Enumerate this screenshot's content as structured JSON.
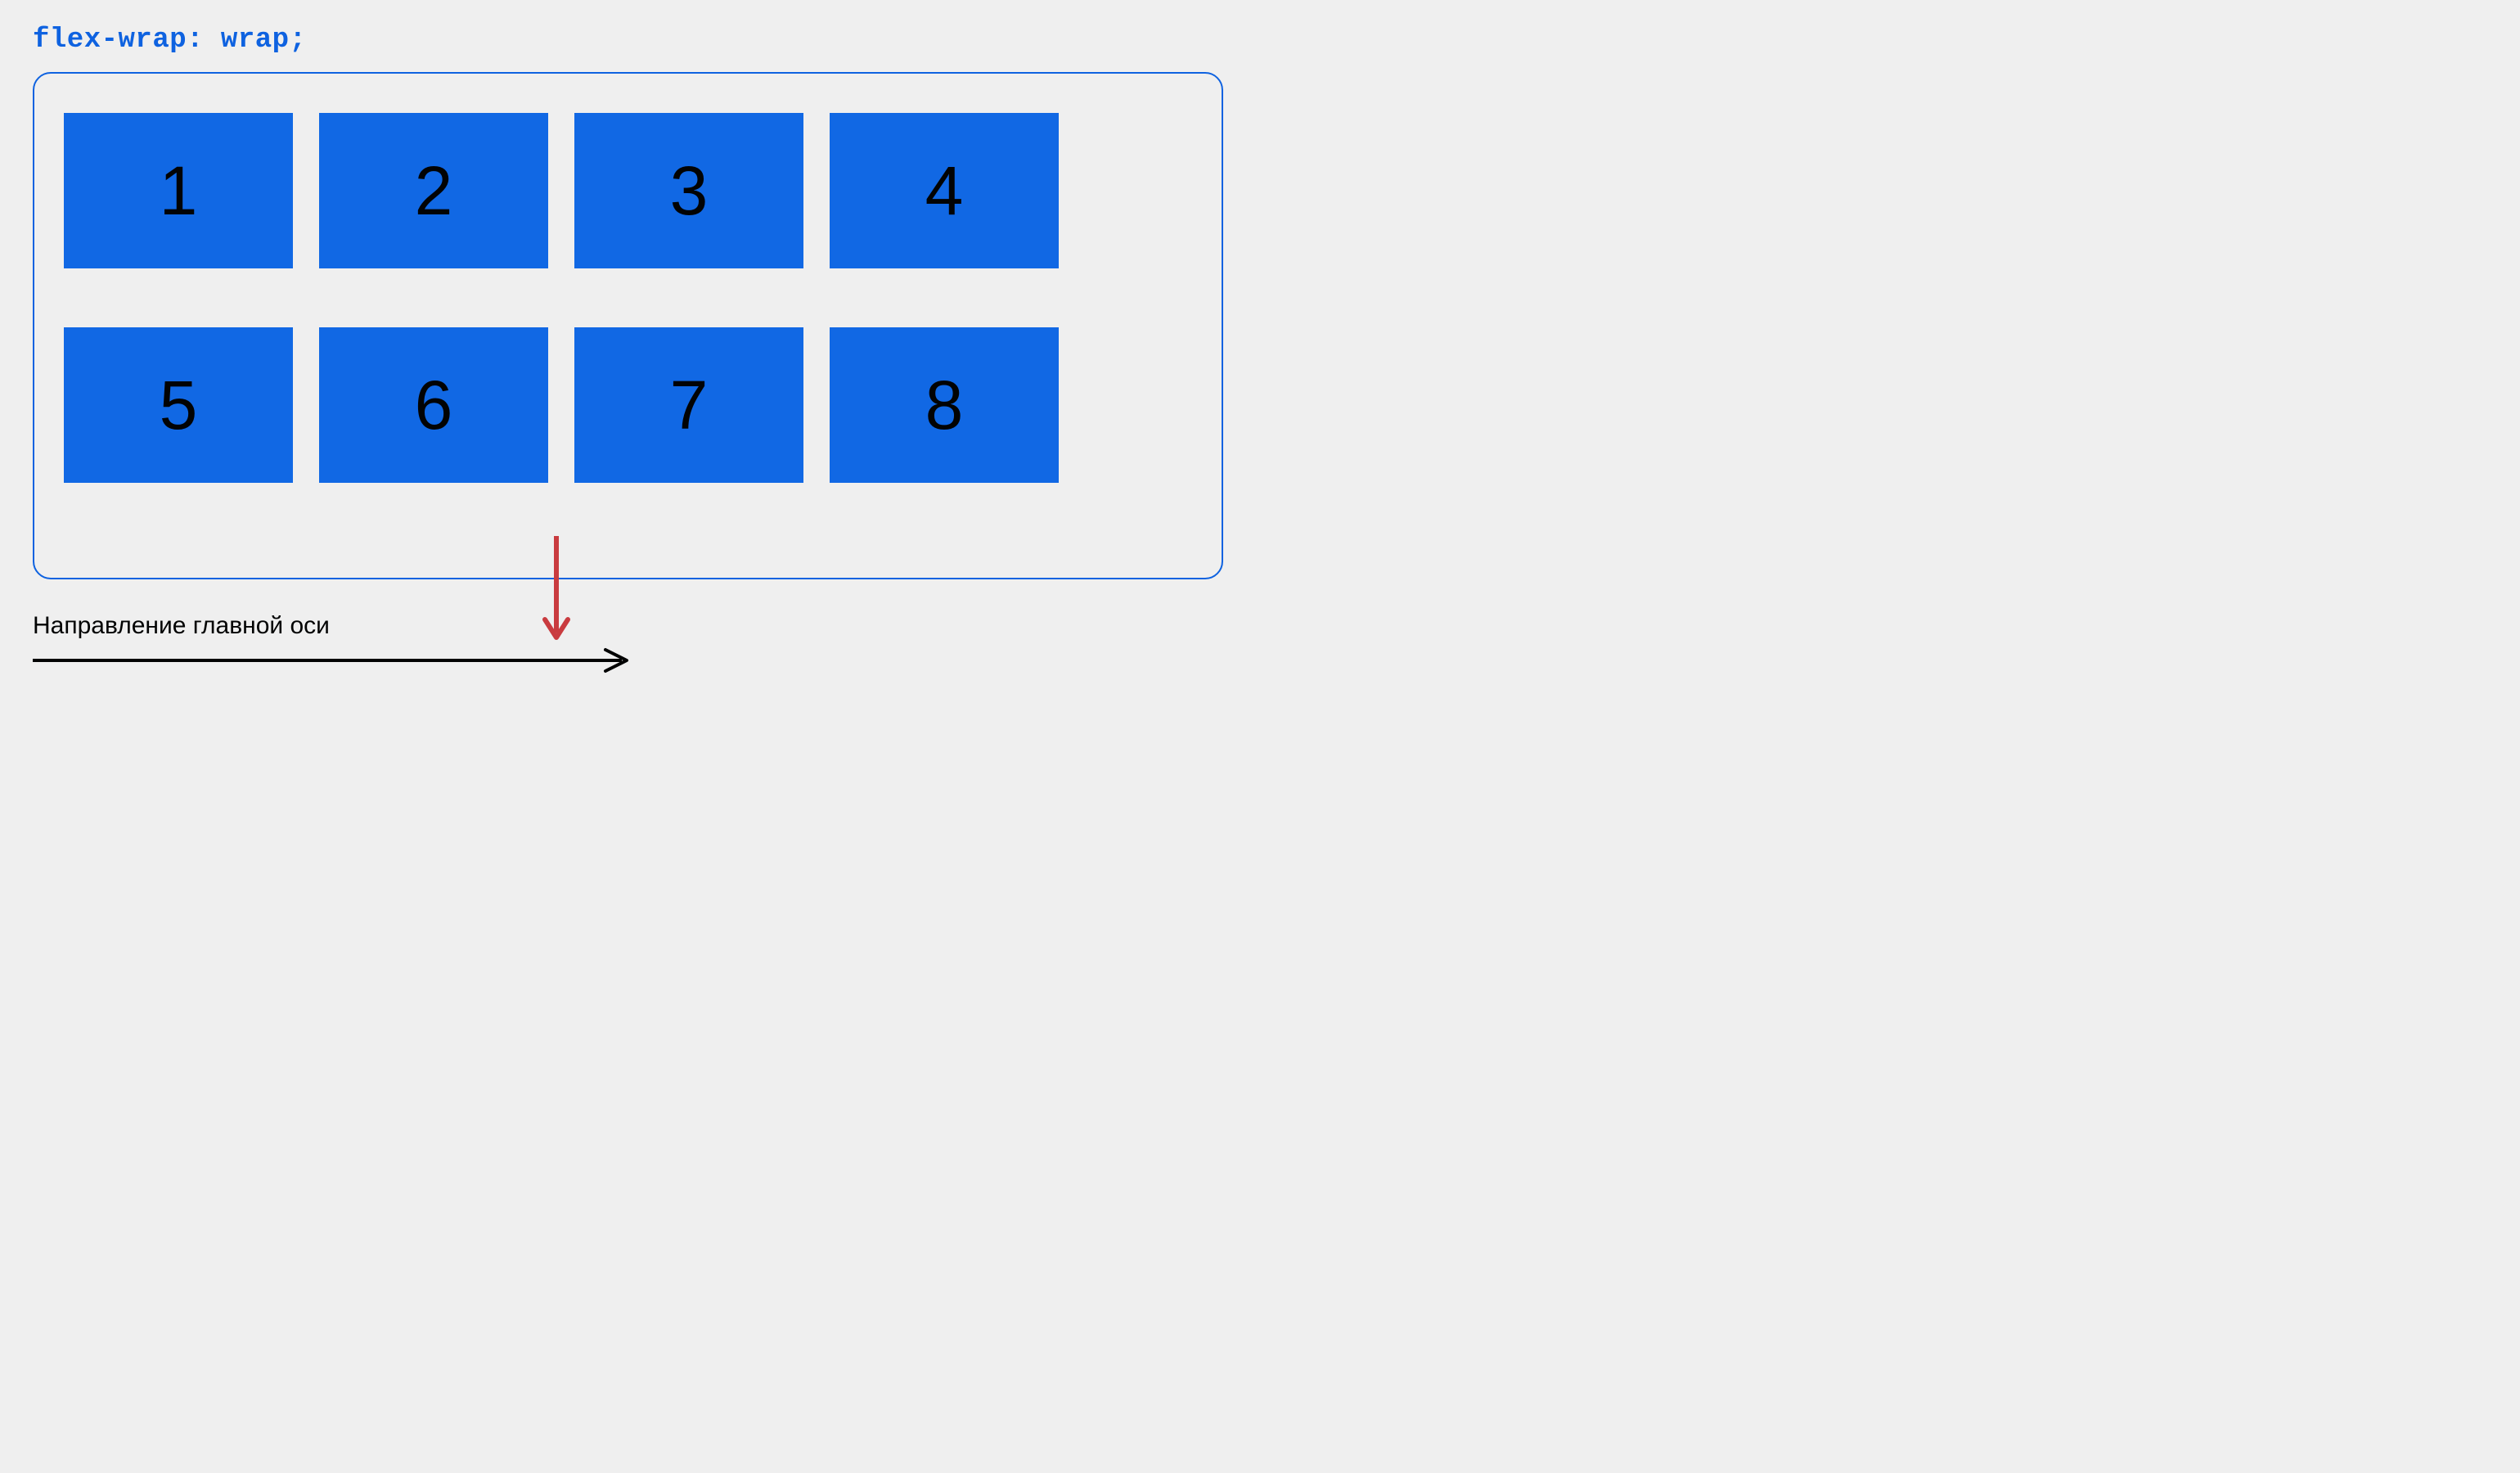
{
  "heading": "flex-wrap: wrap;",
  "items": [
    "1",
    "2",
    "3",
    "4",
    "5",
    "6",
    "7",
    "8"
  ],
  "axis_label": "Направление главной оси",
  "colors": {
    "accent": "#0e62e0",
    "item_bg": "#1168e4",
    "page_bg": "#efefef",
    "wrap_arrow": "#c93b3f",
    "axis_arrow": "#020303"
  }
}
